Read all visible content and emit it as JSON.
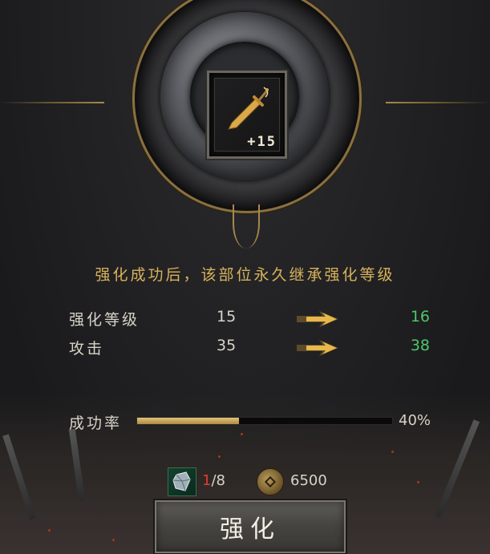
{
  "item": {
    "icon": "dagger-icon",
    "enhance_level": "+15"
  },
  "notice": "强化成功后，该部位永久继承强化等级",
  "stats": [
    {
      "label": "强化等级",
      "current": "15",
      "next": "16"
    },
    {
      "label": "攻击",
      "current": "35",
      "next": "38"
    }
  ],
  "success_rate": {
    "label": "成功率",
    "value": 0.4,
    "text": "40%"
  },
  "cost": {
    "crystal": {
      "icon": "crystal-icon",
      "have": "1",
      "need": "/8"
    },
    "coin": {
      "icon": "coin-icon",
      "amount": "6500"
    }
  },
  "button": {
    "label": "强化"
  },
  "colors": {
    "gold": "#d8b25c",
    "increase_green": "#4cc66a",
    "insufficient_red": "#e03c2c"
  }
}
